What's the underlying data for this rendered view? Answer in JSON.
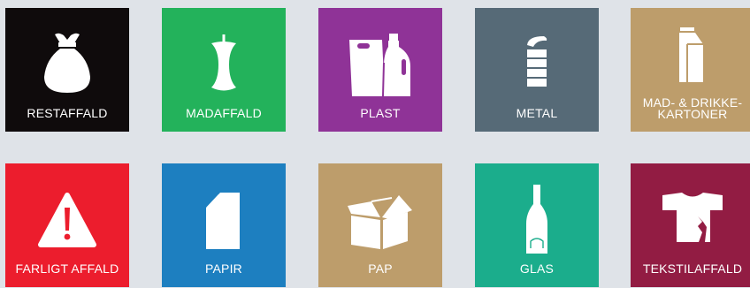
{
  "tiles": [
    {
      "id": "restaffald",
      "label": "RESTAFFALD",
      "color": "#0f0b0c",
      "icon": "trash-bag-icon"
    },
    {
      "id": "madaffald",
      "label": "MADAFFALD",
      "color": "#23b25b",
      "icon": "apple-core-icon"
    },
    {
      "id": "plast",
      "label": "PLAST",
      "color": "#8f3397",
      "icon": "plastic-bottle-bag-icon"
    },
    {
      "id": "metal",
      "label": "METAL",
      "color": "#566a77",
      "icon": "tin-can-icon"
    },
    {
      "id": "mad-drikkekartoner",
      "label_line1": "MAD- & DRIKKE-",
      "label_line2": "KARTONER",
      "color": "#bd9d6b",
      "icon": "milk-carton-icon"
    },
    {
      "id": "farligt-affald",
      "label": "FARLIGT AFFALD",
      "color": "#ec1d2d",
      "icon": "warning-triangle-icon"
    },
    {
      "id": "papir",
      "label": "PAPIR",
      "color": "#1d7fc0",
      "icon": "paper-sheet-icon"
    },
    {
      "id": "pap",
      "label": "PAP",
      "color": "#bd9d6b",
      "icon": "cardboard-box-icon"
    },
    {
      "id": "glas",
      "label": "GLAS",
      "color": "#1bad8c",
      "icon": "glass-bottle-icon"
    },
    {
      "id": "tekstilaffald",
      "label": "TEKSTILAFFALD",
      "color": "#921c43",
      "icon": "torn-tshirt-icon"
    }
  ]
}
